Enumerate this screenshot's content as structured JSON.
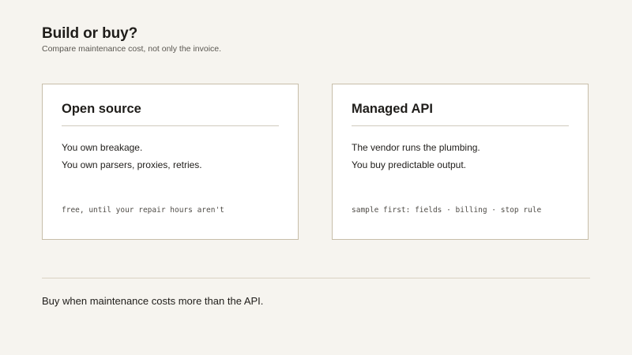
{
  "header": {
    "title": "Build or buy?",
    "subtitle": "Compare maintenance cost, not only the invoice."
  },
  "cards": [
    {
      "title": "Open source",
      "lines": [
        "You own breakage.",
        "You own parsers, proxies, retries."
      ],
      "footnote": "free, until your repair hours aren't"
    },
    {
      "title": "Managed API",
      "lines": [
        "The vendor runs the plumbing.",
        "You buy predictable output."
      ],
      "footnote": "sample first: fields · billing · stop rule"
    }
  ],
  "conclusion": "Buy when maintenance costs more than the API."
}
